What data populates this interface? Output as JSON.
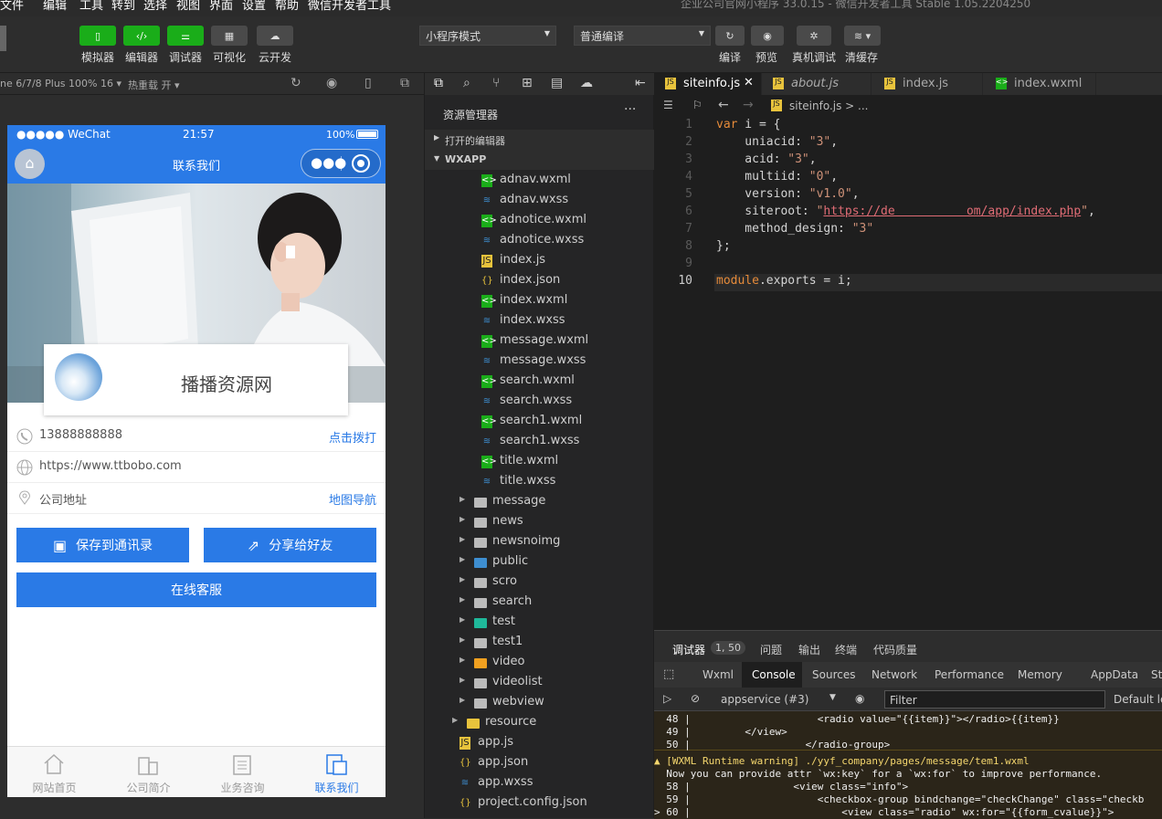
{
  "menu": {
    "items": [
      "文件",
      "编辑",
      "工具",
      "转到",
      "选择",
      "视图",
      "界面",
      "设置",
      "帮助",
      "微信开发者工具"
    ],
    "window_title": "企业公司官网小程序 33.0.15 - 微信开发者工具 Stable 1.05.2204250"
  },
  "toolbar": {
    "simulator": "模拟器",
    "editor": "编辑器",
    "debugger": "调试器",
    "visual": "可视化",
    "cloud": "云开发",
    "mode": "小程序模式",
    "compile_mode": "普通编译",
    "compile": "编译",
    "preview": "预览",
    "remote_debug": "真机调试",
    "clear_cache": "清缓存"
  },
  "subbar": {
    "device": "ne 6/7/8 Plus 100% 16",
    "hot_reload": "热重载 开"
  },
  "phone": {
    "carrier": "●●●●● WeChat",
    "time": "21:57",
    "battery": "100%",
    "title": "联系我们",
    "site_name": "播播资源网",
    "phone": "13888888888",
    "call": "点击拨打",
    "website": "https://www.ttbobo.com",
    "address": "公司地址",
    "map_nav": "地图导航",
    "save_contact": "保存到通讯录",
    "share": "分享给好友",
    "online_service": "在线客服",
    "tabs": [
      "网站首页",
      "公司简介",
      "业务咨询",
      "联系我们"
    ]
  },
  "explorer": {
    "title": "资源管理器",
    "open_editors": "打开的编辑器",
    "root": "WXAPP",
    "files": [
      {
        "name": "adnav.wxml",
        "type": "wxml",
        "indent": 1
      },
      {
        "name": "adnav.wxss",
        "type": "wxss",
        "indent": 1
      },
      {
        "name": "adnotice.wxml",
        "type": "wxml",
        "indent": 1
      },
      {
        "name": "adnotice.wxss",
        "type": "wxss",
        "indent": 1
      },
      {
        "name": "index.js",
        "type": "js",
        "indent": 1
      },
      {
        "name": "index.json",
        "type": "json",
        "indent": 1
      },
      {
        "name": "index.wxml",
        "type": "wxml",
        "indent": 1
      },
      {
        "name": "index.wxss",
        "type": "wxss",
        "indent": 1
      },
      {
        "name": "message.wxml",
        "type": "wxml",
        "indent": 1
      },
      {
        "name": "message.wxss",
        "type": "wxss",
        "indent": 1
      },
      {
        "name": "search.wxml",
        "type": "wxml",
        "indent": 1
      },
      {
        "name": "search.wxss",
        "type": "wxss",
        "indent": 1
      },
      {
        "name": "search1.wxml",
        "type": "wxml",
        "indent": 1
      },
      {
        "name": "search1.wxss",
        "type": "wxss",
        "indent": 1
      },
      {
        "name": "title.wxml",
        "type": "wxml",
        "indent": 1
      },
      {
        "name": "title.wxss",
        "type": "wxss",
        "indent": 1
      },
      {
        "name": "message",
        "type": "folder",
        "indent": 0
      },
      {
        "name": "news",
        "type": "folder",
        "indent": 0
      },
      {
        "name": "newsnoimg",
        "type": "folder",
        "indent": 0
      },
      {
        "name": "public",
        "type": "folder-blue",
        "indent": 0
      },
      {
        "name": "scro",
        "type": "folder",
        "indent": 0
      },
      {
        "name": "search",
        "type": "folder",
        "indent": 0
      },
      {
        "name": "test",
        "type": "folder-green",
        "indent": 0
      },
      {
        "name": "test1",
        "type": "folder",
        "indent": 0
      },
      {
        "name": "video",
        "type": "folder-orange",
        "indent": 0
      },
      {
        "name": "videolist",
        "type": "folder",
        "indent": 0
      },
      {
        "name": "webview",
        "type": "folder",
        "indent": 0
      },
      {
        "name": "resource",
        "type": "folder-yellow",
        "indent": -1
      },
      {
        "name": "app.js",
        "type": "js",
        "indent": -2
      },
      {
        "name": "app.json",
        "type": "json",
        "indent": -2
      },
      {
        "name": "app.wxss",
        "type": "wxss",
        "indent": -2
      },
      {
        "name": "project.config.json",
        "type": "json",
        "indent": -2
      }
    ]
  },
  "editor": {
    "tabs": [
      "siteinfo.js",
      "about.js",
      "index.js",
      "index.wxml"
    ],
    "breadcrumb": "siteinfo.js > ..."
  },
  "code": [
    {
      "n": "1",
      "t": [
        [
          "k",
          "var"
        ],
        [
          "p",
          " i = {"
        ]
      ]
    },
    {
      "n": "2",
      "t": [
        [
          "p",
          "    uniacid: "
        ],
        [
          "s",
          "\"3\""
        ],
        [
          "p",
          ","
        ]
      ]
    },
    {
      "n": "3",
      "t": [
        [
          "p",
          "    acid: "
        ],
        [
          "s",
          "\"3\""
        ],
        [
          "p",
          ","
        ]
      ]
    },
    {
      "n": "4",
      "t": [
        [
          "p",
          "    multiid: "
        ],
        [
          "s",
          "\"0\""
        ],
        [
          "p",
          ","
        ]
      ]
    },
    {
      "n": "5",
      "t": [
        [
          "p",
          "    version: "
        ],
        [
          "s",
          "\"v1.0\""
        ],
        [
          "p",
          ","
        ]
      ]
    },
    {
      "n": "6",
      "t": [
        [
          "p",
          "    siteroot: "
        ],
        [
          "s",
          "\""
        ],
        [
          "u",
          "https://de          om/app/index.php"
        ],
        [
          "s",
          "\""
        ],
        [
          "p",
          ","
        ]
      ]
    },
    {
      "n": "7",
      "t": [
        [
          "p",
          "    method_design: "
        ],
        [
          "s",
          "\"3\""
        ]
      ]
    },
    {
      "n": "8",
      "t": [
        [
          "p",
          "};"
        ]
      ]
    },
    {
      "n": "9",
      "t": [
        [
          "p",
          ""
        ]
      ]
    },
    {
      "n": "10",
      "t": [
        [
          "k",
          "module"
        ],
        [
          "p",
          ".exports = i;"
        ]
      ]
    }
  ],
  "debug": {
    "tab": "调试器",
    "badge": "1, 50",
    "issues": "问题",
    "output": "输出",
    "terminal": "终端",
    "quality": "代码质量",
    "panels": [
      "Wxml",
      "Console",
      "Sources",
      "Network",
      "Performance",
      "Memory",
      "AppData",
      "Stor"
    ],
    "context": "appservice (#3)",
    "filter": "Filter",
    "levels": "Default lev",
    "lines": [
      "  48 |                     <radio value=\"{{item}}\"></radio>{{item}}",
      "  49 |         </view>",
      "  50 |                   </radio-group>",
      "▲ [WXML Runtime warning] ./yyf_company/pages/message/tem1.wxml",
      "  Now you can provide attr `wx:key` for a `wx:for` to improve performance.",
      "  58 |                 <view class=\"info\">",
      "  59 |                     <checkbox-group bindchange=\"checkChange\" class=\"checkb",
      "> 60 |                         <view class=\"radio\" wx:for=\"{{form_cvalue}}\">"
    ]
  },
  "colors": {
    "accent": "#2a7ae6",
    "green": "#1aad19"
  }
}
